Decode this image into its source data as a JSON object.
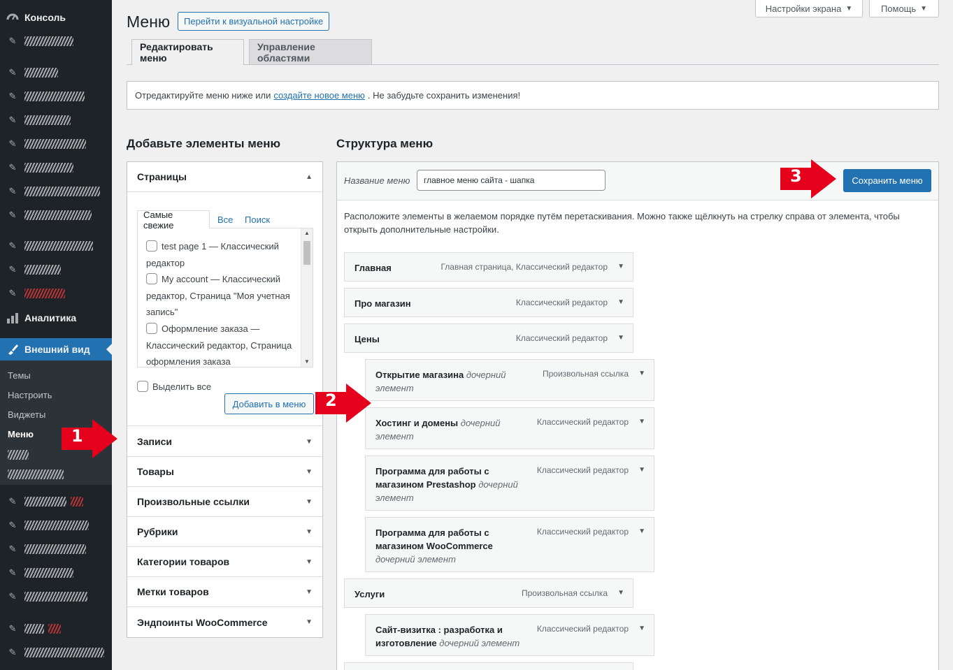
{
  "sidebar": {
    "console_label": "Консоль",
    "analytics_label": "Аналитика",
    "appearance_label": "Внешний вид",
    "submenu": [
      "Темы",
      "Настроить",
      "Виджеты",
      "Меню"
    ]
  },
  "top_buttons": {
    "screen_options": "Настройки экрана",
    "help": "Помощь"
  },
  "header": {
    "title": "Меню",
    "visual_button": "Перейти к визуальной настройке"
  },
  "tabs": [
    "Редактировать меню",
    "Управление областями"
  ],
  "notice": {
    "before": "Отредактируйте меню ниже или",
    "link": "создайте новое меню",
    "after": ". Не забудьте сохранить изменения!"
  },
  "left": {
    "heading": "Добавьте элементы меню",
    "pages_title": "Страницы",
    "page_tabs": [
      "Самые свежие",
      "Все",
      "Поиск"
    ],
    "pages": [
      "test page 1 — Классический редактор",
      "My account — Классический редактор, Страница \"Моя учетная запись\"",
      "Оформление заказа — Классический редактор, Страница оформления заказа"
    ],
    "select_all": "Выделить все",
    "add_button": "Добавить в меню",
    "sections": [
      "Записи",
      "Товары",
      "Произвольные ссылки",
      "Рубрики",
      "Категории товаров",
      "Метки товаров",
      "Эндпоинты WooCommerce"
    ]
  },
  "right": {
    "heading": "Структура меню",
    "menu_name_label": "Название меню",
    "menu_name_value": "главное меню сайта - шапка",
    "save_button": "Сохранить меню",
    "instructions": "Расположите элементы в желаемом порядке путём перетаскивания. Можно также щёлкнуть на стрелку справа от элемента, чтобы открыть дополнительные настройки.",
    "sub_label": "дочерний элемент",
    "items": [
      {
        "title": "Главная",
        "type": "Главная страница, Классический редактор"
      },
      {
        "title": "Про магазин",
        "type": "Классический редактор"
      },
      {
        "title": "Цены",
        "type": "Классический редактор"
      },
      {
        "title": "Открытие магазина",
        "type": "Произвольная ссылка"
      },
      {
        "title": "Хостинг и домены",
        "type": "Классический редактор"
      },
      {
        "title": "Программа для работы с магазином Prestashop",
        "type": "Классический редактор"
      },
      {
        "title": "Программа для работы с магазином WooCommerce",
        "type": "Классический редактор"
      },
      {
        "title": "Услуги",
        "type": "Произвольная ссылка"
      },
      {
        "title": "Сайт-визитка : разработка и изготовление",
        "type": "Классический редактор"
      }
    ]
  },
  "annotations": [
    "1",
    "2",
    "3"
  ],
  "colors": {
    "accent": "#2271b1",
    "sidebar": "#1d2327",
    "arrow": "#e5001b"
  }
}
